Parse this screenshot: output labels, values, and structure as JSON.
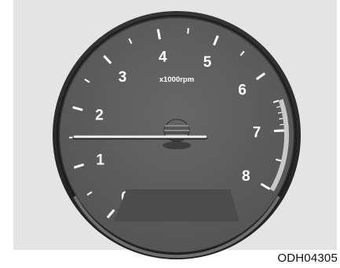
{
  "tachometer": {
    "unit_label": "x1000rpm",
    "scale_labels": [
      "0",
      "1",
      "2",
      "3",
      "4",
      "5",
      "6",
      "7",
      "8"
    ],
    "scale_min": 0,
    "scale_max": 8,
    "needle_value": 1,
    "redline_start": 6.5,
    "colors": {
      "background": "#e4e4e4",
      "bezel": "#2b2b2b",
      "face": "#5e5e5e",
      "ticks": "#ffffff",
      "redline_band": "#c9c9c9",
      "needle": "#f2f2f2",
      "display": "#4c4c4c"
    }
  },
  "image_code": "ODH04305"
}
